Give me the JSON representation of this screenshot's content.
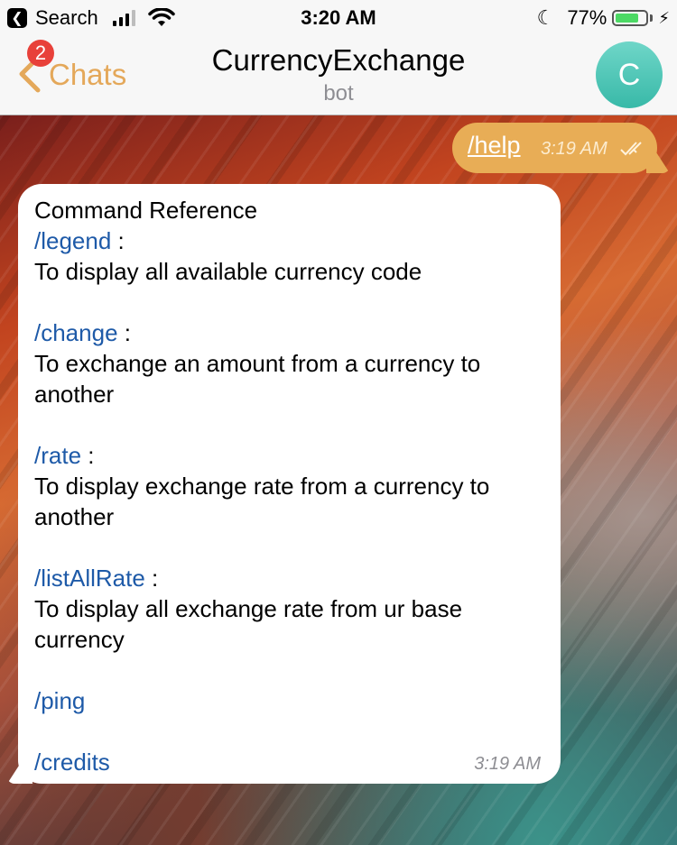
{
  "status_bar": {
    "back_app_label": "Search",
    "time": "3:20 AM",
    "battery": "77%",
    "battery_level": 0.77
  },
  "nav": {
    "back_label": "Chats",
    "unread_count": "2",
    "title": "CurrencyExchange",
    "subtitle": "bot",
    "avatar_letter": "C"
  },
  "outgoing": {
    "text": "/help",
    "time": "3:19 AM"
  },
  "incoming": {
    "heading": "Command Reference",
    "commands": [
      {
        "cmd": "/legend",
        "desc": "To display all available currency code"
      },
      {
        "cmd": "/change",
        "desc_line1": "To exchange an amount from a currency to",
        "desc_line2": "another"
      },
      {
        "cmd": "/rate",
        "desc_line1": "To display exchange rate from a currency to",
        "desc_line2": "another"
      },
      {
        "cmd": "/listAllRate",
        "desc_line1": "To display all exchange rate from ur base",
        "desc_line2": "currency"
      },
      {
        "cmd": "/ping"
      },
      {
        "cmd": "/credits"
      }
    ],
    "separator": " :",
    "time": "3:19 AM"
  },
  "colors": {
    "accent": "#e4a85a",
    "badge": "#e8413a",
    "link": "#1e5aa8",
    "outgoing_bubble": "#e8ad56",
    "avatar": "#4cc4b4"
  }
}
